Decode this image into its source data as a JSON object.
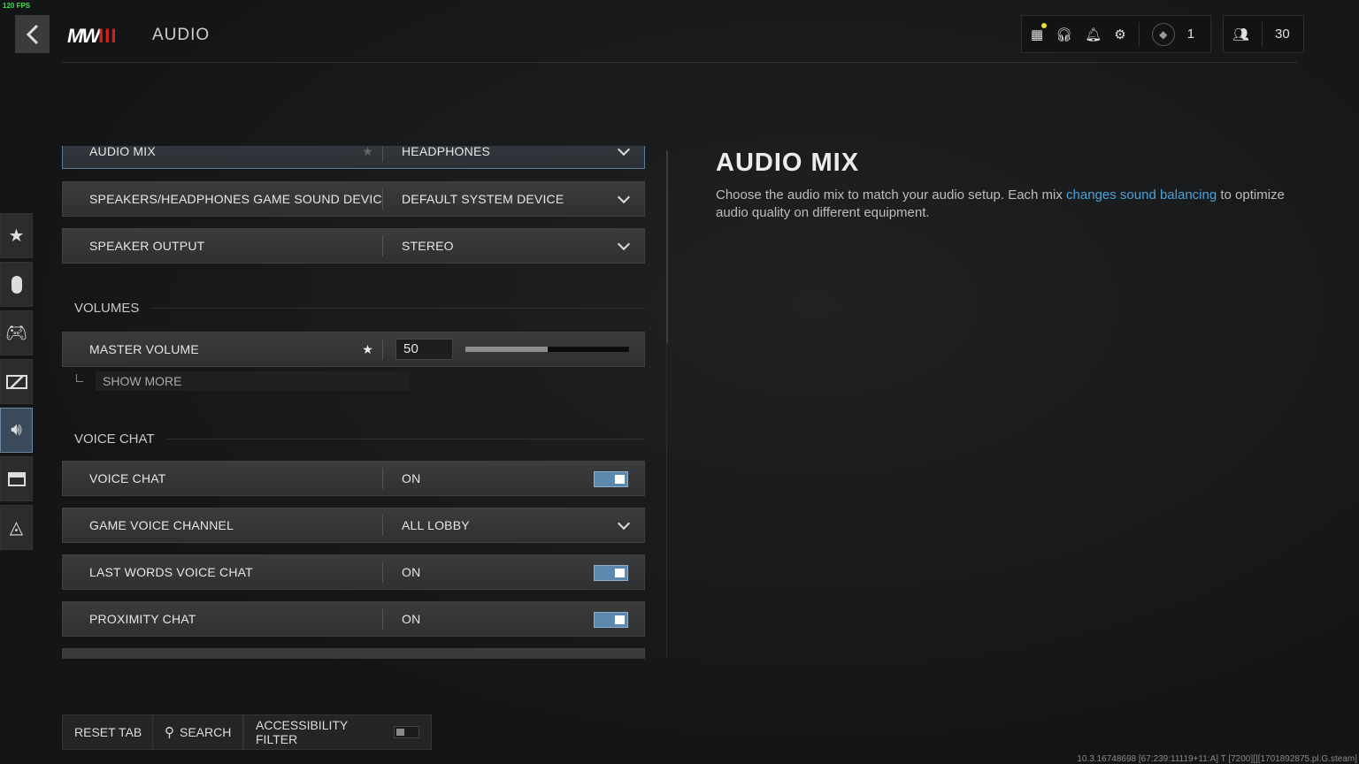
{
  "fps": "120 FPS",
  "header": {
    "logo": "MW",
    "logo_mark": "III",
    "title": "AUDIO",
    "level": "1",
    "players": "30",
    "accent": "#d0211c"
  },
  "sidebar": [
    "favorites",
    "mouse-keyboard",
    "controller",
    "graphics",
    "audio",
    "interface",
    "account-network"
  ],
  "settings": {
    "audio_mix": {
      "label": "AUDIO MIX",
      "value": "HEADPHONES"
    },
    "device": {
      "label": "SPEAKERS/HEADPHONES GAME SOUND DEVICE",
      "value": "DEFAULT SYSTEM DEVICE"
    },
    "speaker_output": {
      "label": "SPEAKER OUTPUT",
      "value": "STEREO"
    },
    "volumes_header": "VOLUMES",
    "master_volume": {
      "label": "MASTER VOLUME",
      "value": "50",
      "percent": 50
    },
    "show_more": "SHOW MORE",
    "voice_header": "VOICE CHAT",
    "voice_chat": {
      "label": "VOICE CHAT",
      "value": "ON"
    },
    "game_voice_channel": {
      "label": "GAME VOICE CHANNEL",
      "value": "ALL LOBBY"
    },
    "last_words": {
      "label": "LAST WORDS VOICE CHAT",
      "value": "ON"
    },
    "proximity": {
      "label": "PROXIMITY CHAT",
      "value": "ON"
    }
  },
  "detail": {
    "title": "AUDIO MIX",
    "text_before": "Choose the audio mix to match your audio setup. Each mix ",
    "link": "changes sound balancing",
    "text_after": " to optimize audio quality on different equipment."
  },
  "footer": {
    "reset": "RESET TAB",
    "search": "SEARCH",
    "accessibility": "ACCESSIBILITY FILTER",
    "accessibility_on": false
  },
  "version": "10.3.16748698 [67:239:11119+11:A] T [7200][][1701892875.pl.G.steam]"
}
